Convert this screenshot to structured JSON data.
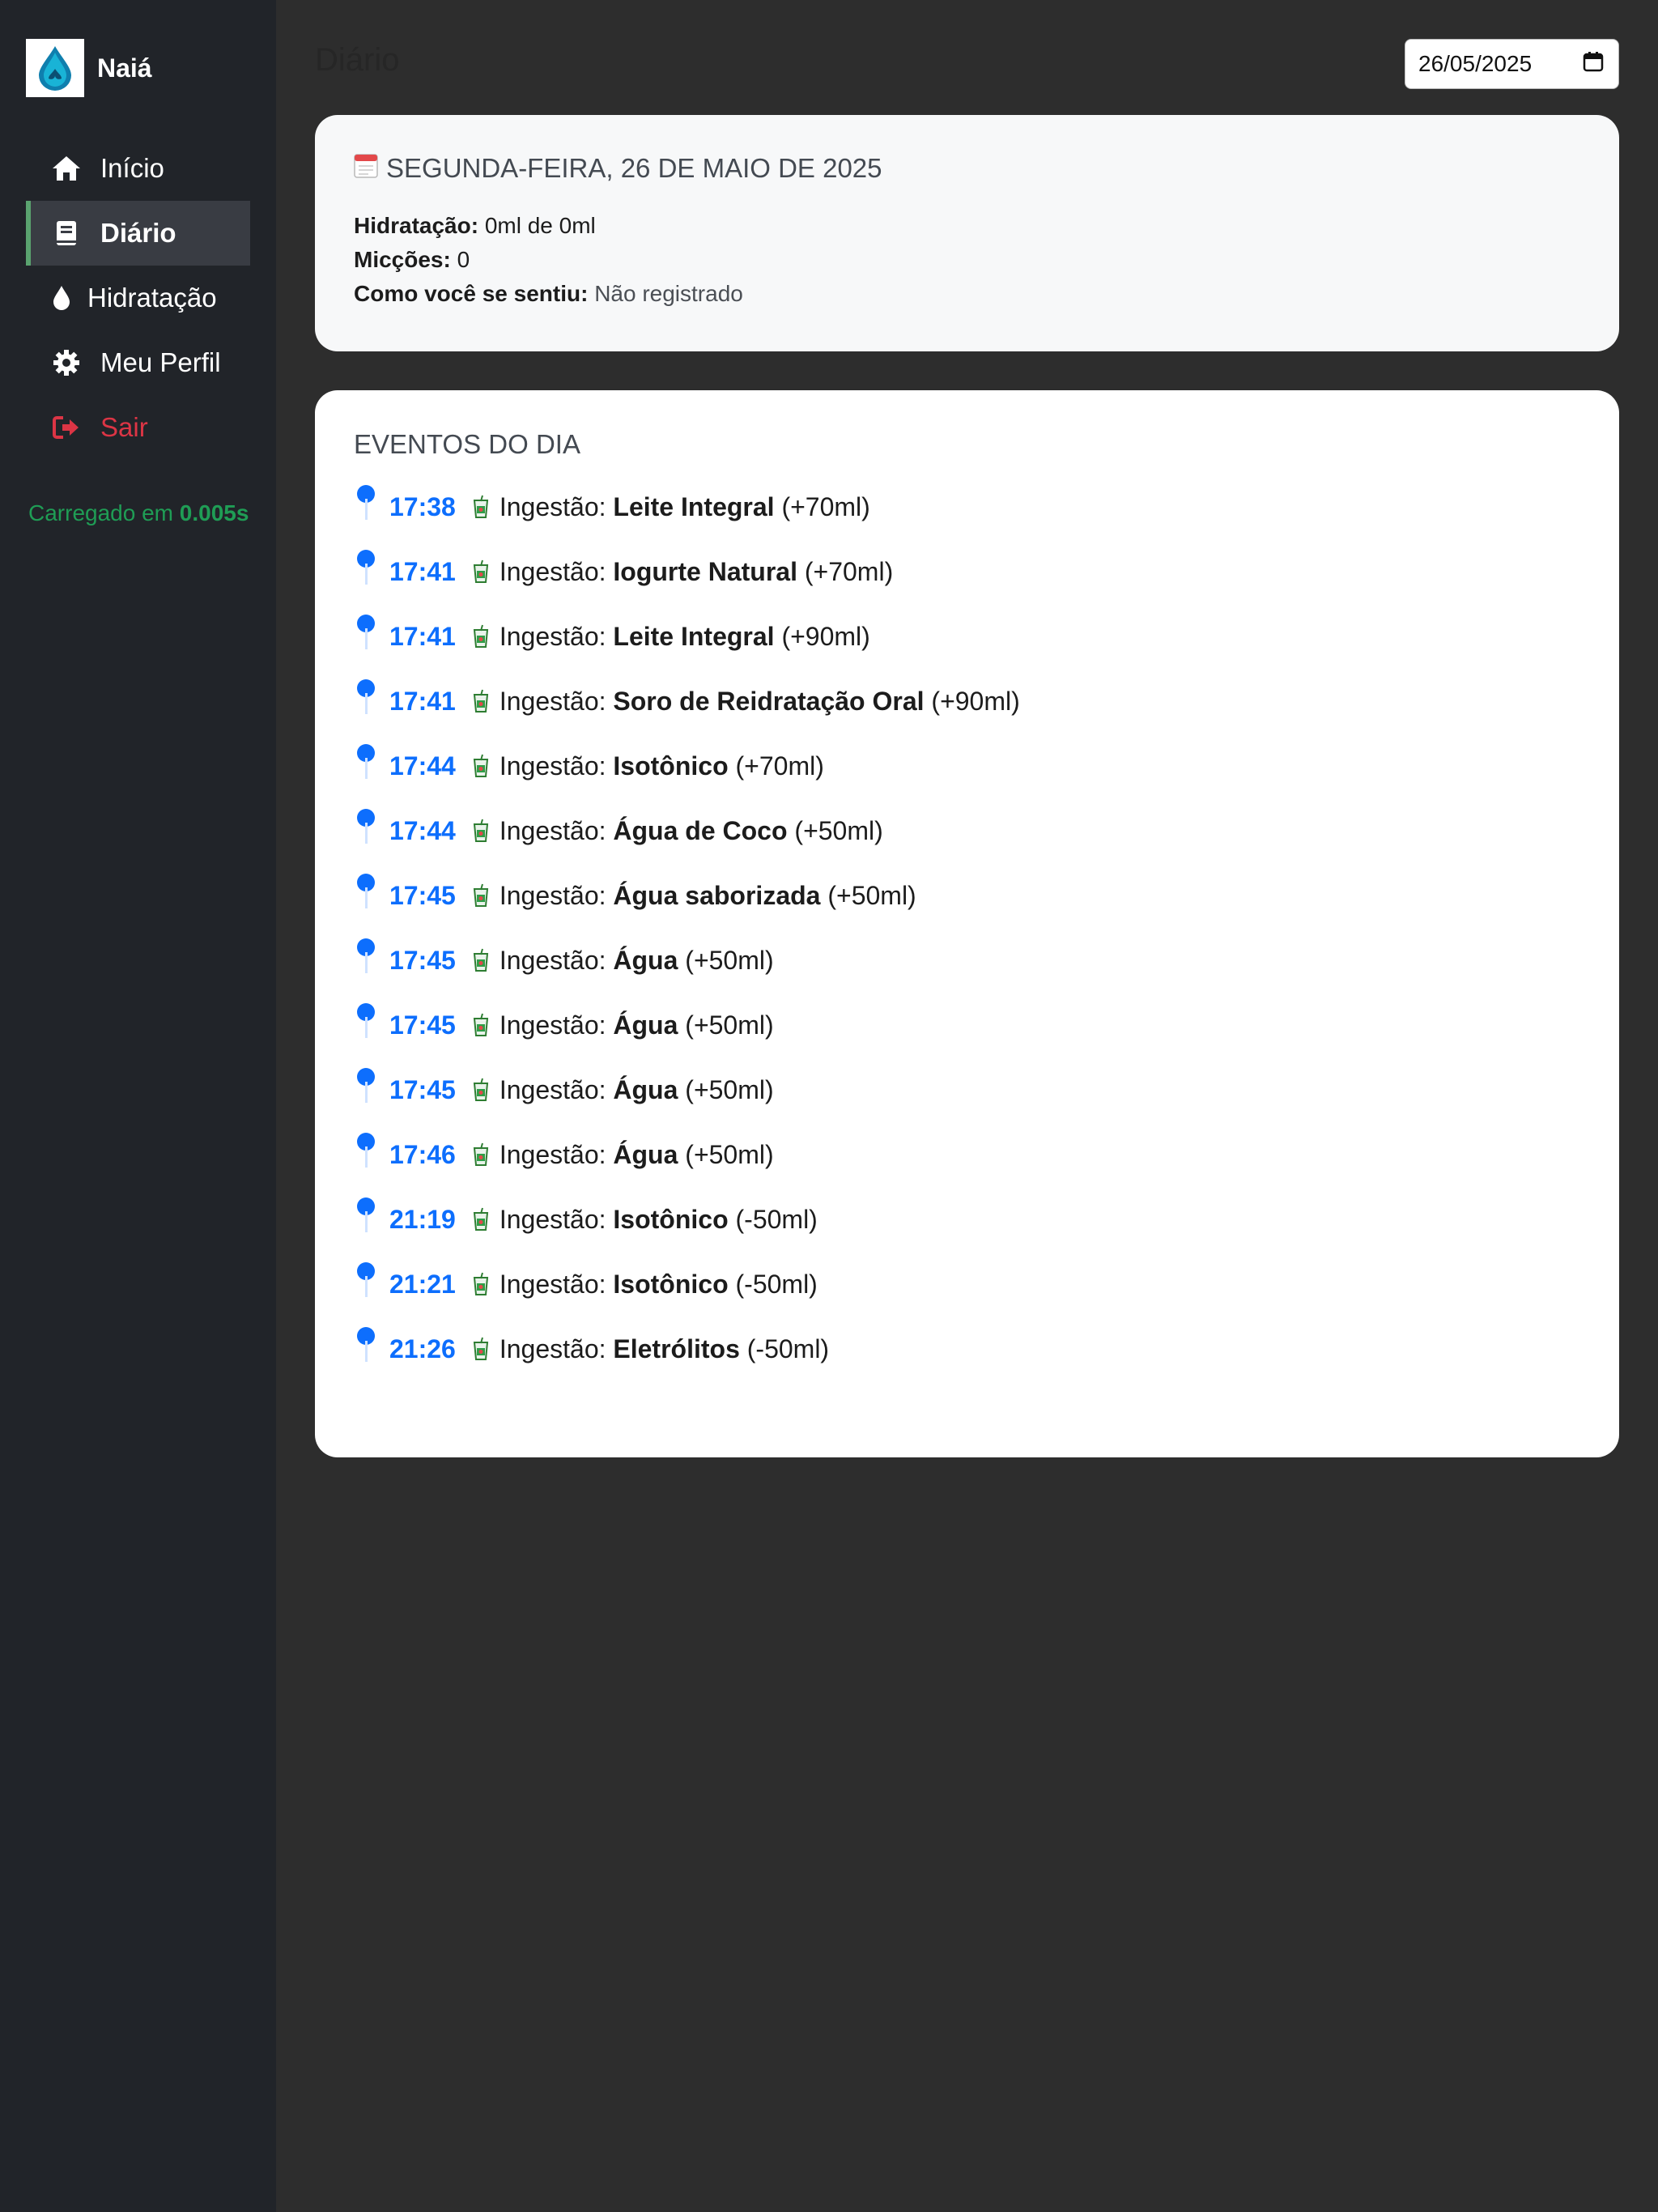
{
  "sidebar": {
    "brand": "Naiá",
    "items": [
      {
        "label": "Início",
        "icon": "home-icon"
      },
      {
        "label": "Diário",
        "icon": "book-icon",
        "active": true
      },
      {
        "label": "Hidratação",
        "icon": "droplet-icon"
      },
      {
        "label": "Meu Perfil",
        "icon": "gear-icon"
      },
      {
        "label": "Sair",
        "icon": "logout-icon"
      }
    ],
    "load_prefix": "Carregado em ",
    "load_time": "0.005s"
  },
  "header": {
    "title": "Diário",
    "date_value": "26/05/2025"
  },
  "summary": {
    "date_heading": "SEGUNDA-FEIRA, 26 DE MAIO DE 2025",
    "hydration_label": "Hidratação:",
    "hydration_value": "0ml de 0ml",
    "urination_label": "Micções:",
    "urination_value": "0",
    "feeling_label": "Como você se sentiu:",
    "feeling_value": "Não registrado"
  },
  "events": {
    "title": "EVENTOS DO DIA",
    "prefix": "Ingestão:",
    "items": [
      {
        "time": "17:38",
        "drink": "Leite Integral",
        "amount": "(+70ml)"
      },
      {
        "time": "17:41",
        "drink": "Iogurte Natural",
        "amount": "(+70ml)"
      },
      {
        "time": "17:41",
        "drink": "Leite Integral",
        "amount": "(+90ml)"
      },
      {
        "time": "17:41",
        "drink": "Soro de Reidratação Oral",
        "amount": "(+90ml)"
      },
      {
        "time": "17:44",
        "drink": "Isotônico",
        "amount": "(+70ml)"
      },
      {
        "time": "17:44",
        "drink": "Água de Coco",
        "amount": "(+50ml)"
      },
      {
        "time": "17:45",
        "drink": "Água saborizada",
        "amount": "(+50ml)"
      },
      {
        "time": "17:45",
        "drink": "Água",
        "amount": "(+50ml)"
      },
      {
        "time": "17:45",
        "drink": "Água",
        "amount": "(+50ml)"
      },
      {
        "time": "17:45",
        "drink": "Água",
        "amount": "(+50ml)"
      },
      {
        "time": "17:46",
        "drink": "Água",
        "amount": "(+50ml)"
      },
      {
        "time": "21:19",
        "drink": "Isotônico",
        "amount": "(-50ml)"
      },
      {
        "time": "21:21",
        "drink": "Isotônico",
        "amount": "(-50ml)"
      },
      {
        "time": "21:26",
        "drink": "Eletrólitos",
        "amount": "(-50ml)"
      }
    ]
  },
  "colors": {
    "accent": "#0d6efd",
    "active_border": "#5aa36f",
    "logout": "#dc3545",
    "load_text": "#1f9d55"
  }
}
